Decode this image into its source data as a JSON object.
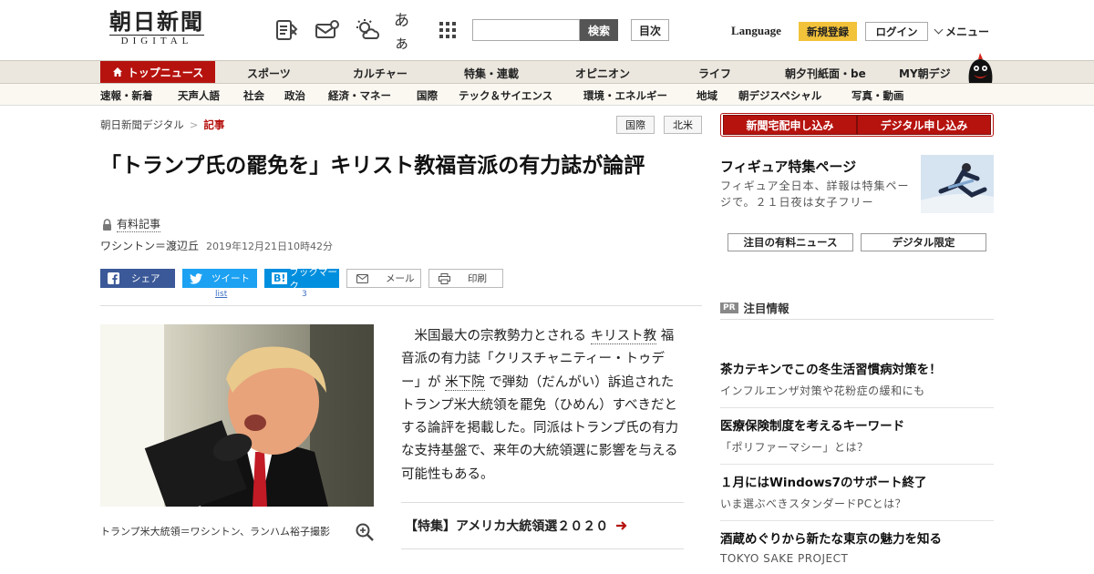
{
  "header": {
    "logo_main": "朝日新聞",
    "logo_sub": "DIGITAL",
    "icons": [
      "list-icon",
      "mail-icon",
      "weather-icon",
      "font-size-icon",
      "grid-icon"
    ],
    "font_size_label": "あぁ",
    "search_placeholder": "",
    "search_button": "検索",
    "contents_button": "目次",
    "language": "Language",
    "register": "新規登録",
    "login": "ログイン",
    "menu": "メニュー"
  },
  "nav_main": {
    "top_news": "トップニュース",
    "items": [
      "スポーツ",
      "カルチャー",
      "特集・連載",
      "オピニオン",
      "ライフ",
      "朝夕刊紙面・be",
      "MY朝デジ"
    ]
  },
  "nav_sub": {
    "items": [
      "速報・新着",
      "天声人語",
      "社会",
      "政治",
      "経済・マネー",
      "国際",
      "テック＆サイエンス",
      "環境・エネルギー",
      "地域",
      "朝デジスペシャル",
      "写真・動画"
    ]
  },
  "breadcrumb": {
    "home": "朝日新聞デジタル",
    "sep": ">",
    "current": "記事"
  },
  "tags": [
    "国際",
    "北米"
  ],
  "article": {
    "title": "「トランプ氏の罷免を」キリスト教福音派の有力誌が論評",
    "paid_label": "有料記事",
    "author": "ワシントン＝渡辺丘",
    "date": "2019年12月21日10時42分",
    "photo_caption": "トランプ米大統領＝ワシントン、ランハム裕子撮影",
    "body_parts": [
      "米国最大の宗教勢力とされる",
      "キリスト教",
      "福音派の有力誌「クリスチャニティー・トゥデー」が",
      "米下院",
      "で弾劾（だんがい）訴追されたトランプ米大統領を罷免（ひめん）すべきだとする論評を掲載した。同派はトランプ氏の有力な支持基盤で、来年の大統領選に影響を与える可能性もある。"
    ],
    "feature_link": "【特集】アメリカ大統領選２０２０"
  },
  "share": {
    "facebook": "シェア",
    "twitter": "ツイート",
    "twitter_count": "list",
    "hatena": "ブックマーク",
    "hatena_icon": "B!",
    "hatena_count": "3",
    "mail": "メール",
    "print": "印刷"
  },
  "sidebar": {
    "subscribe_paper": "新聞宅配申し込み",
    "subscribe_digital": "デジタル申し込み",
    "figure_title": "フィギュア特集ページ",
    "figure_desc": "フィギュア全日本、詳報は特集ページで。２１日夜は女子フリー",
    "btn_paid_news": "注目の有料ニュース",
    "btn_digital_only": "デジタル限定",
    "pr_badge": "PR",
    "pr_title": "注目情報",
    "ads": [
      {
        "headline": "茶カテキンでこの冬生活習慣病対策を！",
        "sub": "インフルエンザ対策や花粉症の緩和にも"
      },
      {
        "headline": "医療保険制度を考えるキーワード",
        "sub": "「ポリファーマシー」とは？"
      },
      {
        "headline": "１月にはWindows7のサポート終了",
        "sub": "いま選ぶべきスタンダードPCとは？"
      },
      {
        "headline": "酒蔵めぐりから新たな東京の魅力を知る",
        "sub": "TOKYO SAKE PROJECT"
      }
    ]
  },
  "colors": {
    "brand_red": "#b6130f",
    "accent_yellow": "#f2c23a",
    "facebook": "#3b5998",
    "twitter": "#1da1f2",
    "hatena": "#008fde"
  }
}
